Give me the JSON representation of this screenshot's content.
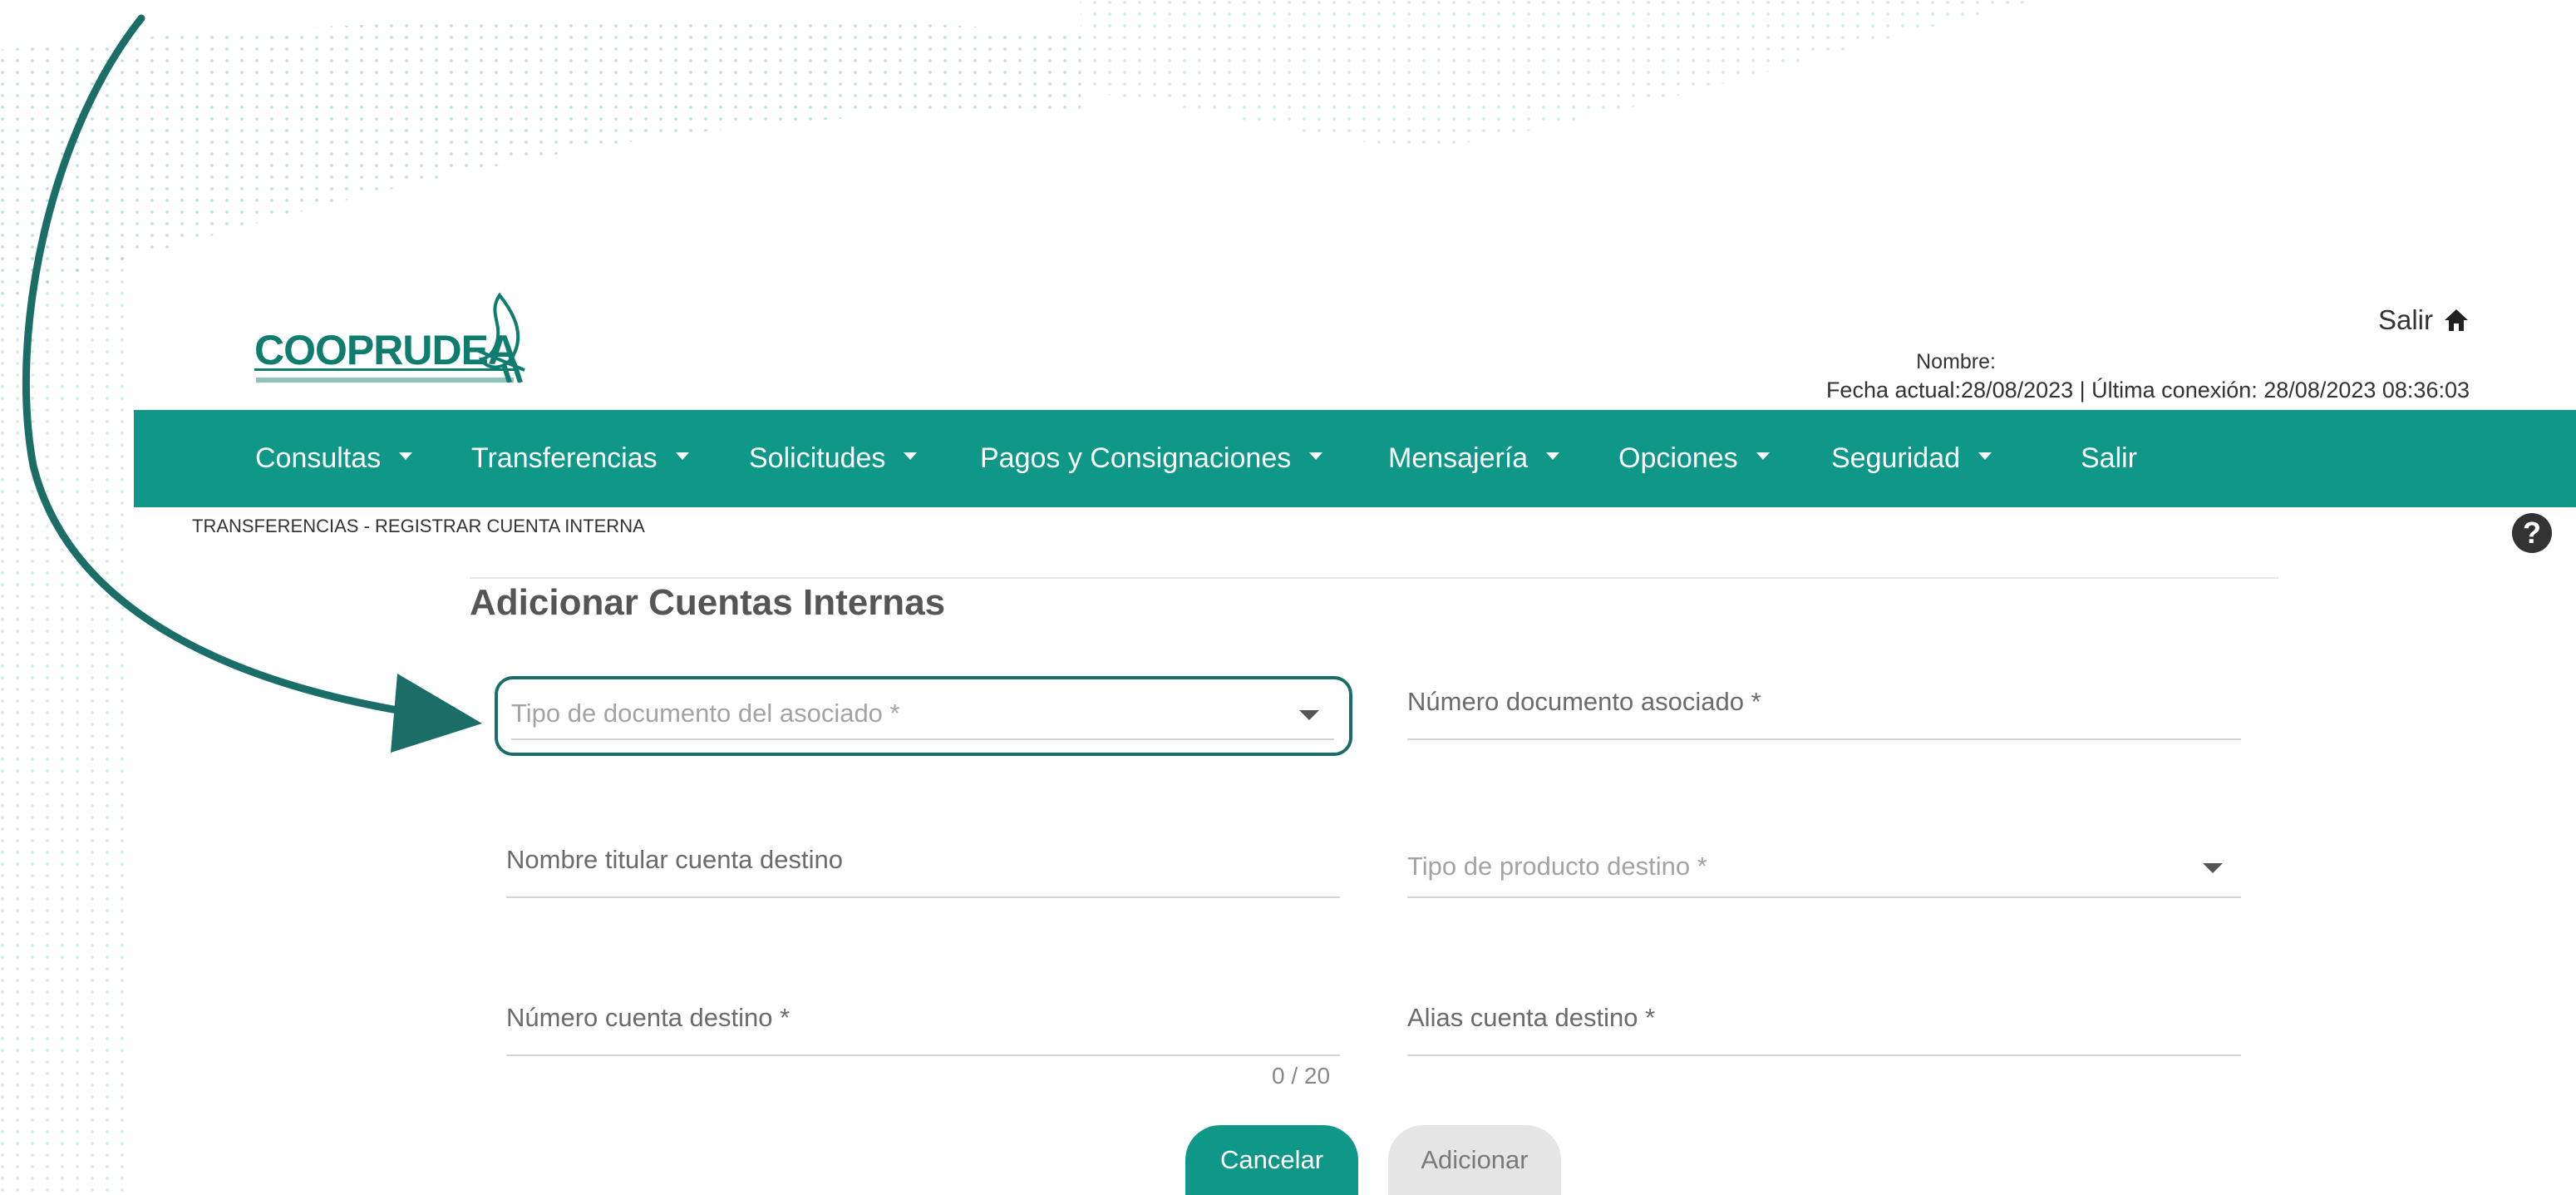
{
  "header": {
    "exit_label": "Salir",
    "name_label": "Nombre:",
    "session_info": "Fecha actual:28/08/2023 | Última conexión: 28/08/2023 08:36:03"
  },
  "brand": {
    "logo_text": "COOPRUDEA"
  },
  "menu": [
    {
      "label": "Consultas",
      "has_dropdown": true
    },
    {
      "label": "Transferencias",
      "has_dropdown": true
    },
    {
      "label": "Solicitudes",
      "has_dropdown": true
    },
    {
      "label": "Pagos y Consignaciones",
      "has_dropdown": true
    },
    {
      "label": "Mensajería",
      "has_dropdown": true
    },
    {
      "label": "Opciones",
      "has_dropdown": true
    },
    {
      "label": "Seguridad",
      "has_dropdown": true
    },
    {
      "label": "Salir",
      "has_dropdown": false
    }
  ],
  "breadcrumb": "TRANSFERENCIAS - REGISTRAR CUENTA INTERNA",
  "help_icon": "?",
  "page_title": "Adicionar Cuentas Internas",
  "form": {
    "doc_type": {
      "placeholder": "Tipo de documento del asociado *"
    },
    "doc_number": {
      "label": "Número documento asociado *"
    },
    "holder_name": {
      "label": "Nombre titular cuenta destino"
    },
    "product_type": {
      "placeholder": "Tipo de producto destino *"
    },
    "account_number": {
      "label": "Número cuenta destino *",
      "counter": "0 / 20"
    },
    "alias": {
      "label": "Alias cuenta destino *"
    }
  },
  "buttons": {
    "cancel": "Cancelar",
    "add": "Adicionar"
  },
  "colors": {
    "brand_teal": "#0f9887",
    "focus_border": "#1b6e68",
    "arrow": "#1b6e68"
  },
  "icons": [
    "home-icon",
    "help-icon",
    "dropdown-caret-icon",
    "annotation-arrow"
  ]
}
